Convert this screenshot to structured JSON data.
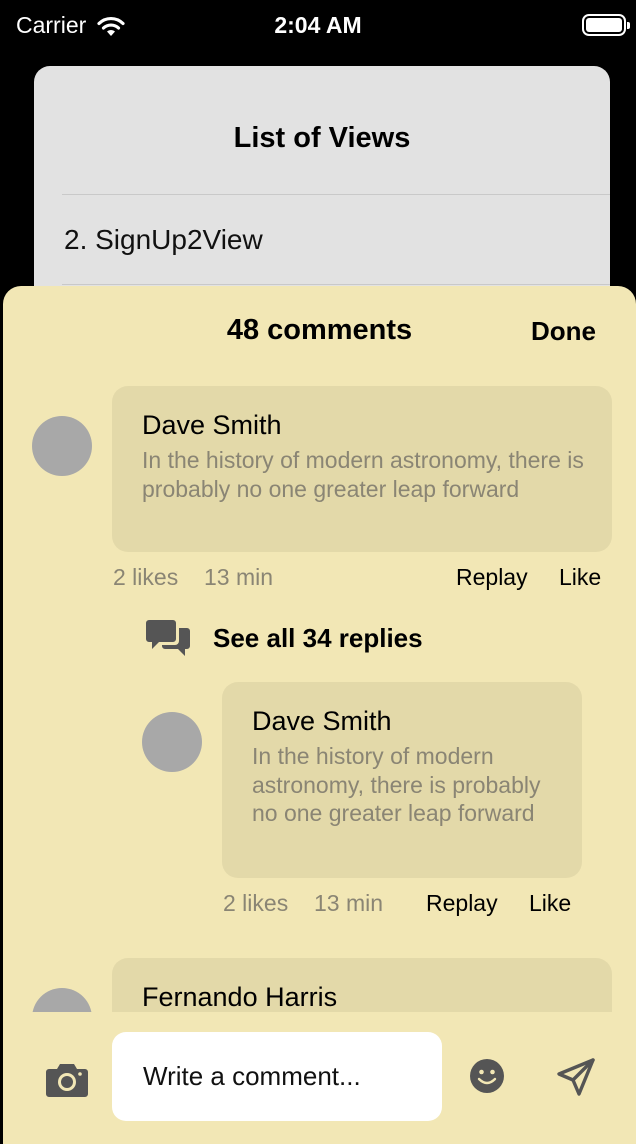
{
  "status_bar": {
    "carrier": "Carrier",
    "time": "2:04 AM"
  },
  "background_card": {
    "title": "List of Views",
    "item": "2. SignUp2View"
  },
  "sheet": {
    "title": "48 comments",
    "done_label": "Done"
  },
  "comments": [
    {
      "author": "Dave Smith",
      "body": "In the history of modern astronomy, there is probably no one greater leap forward",
      "likes": "2 likes",
      "time": "13 min",
      "reply_label": "Replay",
      "like_label": "Like"
    },
    {
      "author": "Fernando Harris"
    }
  ],
  "replies_link": {
    "label": "See all 34 replies"
  },
  "reply": {
    "author": "Dave Smith",
    "body": "In the history of modern astronomy, there is probably no one greater leap forward",
    "likes": "2 likes",
    "time": "13 min",
    "reply_label": "Replay",
    "like_label": "Like"
  },
  "input": {
    "placeholder": "Write a comment..."
  },
  "icons": {
    "wifi": "wifi-icon",
    "battery": "battery-icon",
    "replies": "chat-bubbles-icon",
    "camera": "camera-icon",
    "emoji": "smiley-icon",
    "send": "send-icon"
  },
  "colors": {
    "sheet_background": "#f2e7b5",
    "bubble_background": "#e3d9a9",
    "avatar": "#a8a8a8",
    "secondary_text": "#8a8574"
  }
}
